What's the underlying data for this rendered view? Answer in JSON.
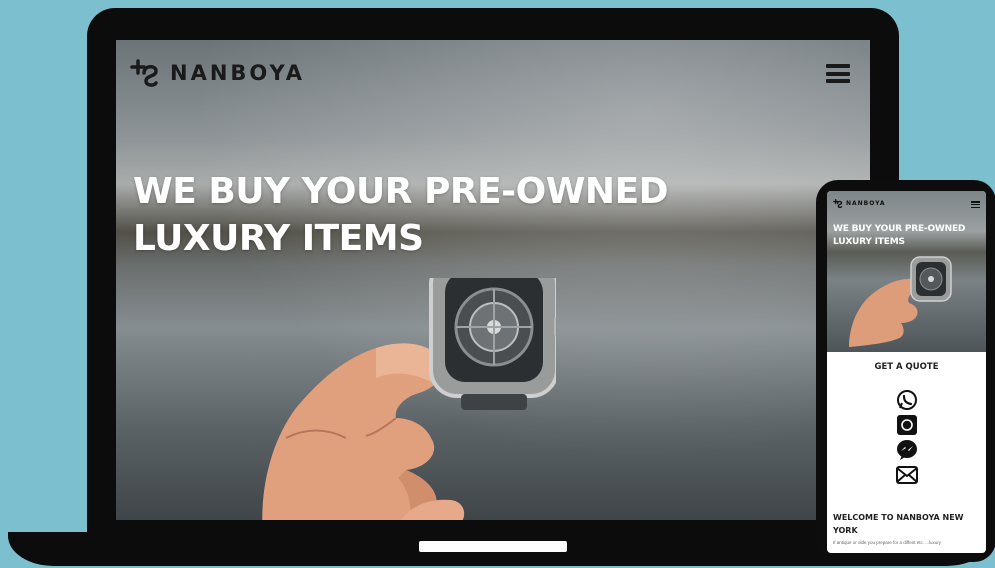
{
  "brand": {
    "name": "NANBOYA",
    "text_color": "#1a1a1a"
  },
  "desktop": {
    "headline_lines": [
      "WE BUY YOUR PRE-OWNED",
      "LUXURY ITEMS"
    ],
    "menu_icon": "hamburger-menu-icon"
  },
  "mobile": {
    "brand_name": "NANBOYA",
    "headline_lines": [
      "WE BUY YOUR PRE-OWNED",
      "LUXURY ITEMS"
    ],
    "quote_title": "GET A QUOTE",
    "contact_icons": [
      "whatsapp-icon",
      "instagram-icon",
      "messenger-icon",
      "email-icon"
    ],
    "welcome_lines": [
      "WELCOME TO NANBOYA NEW",
      "YORK"
    ],
    "welcome_body": "If antique or olde you prepare for a diffent etc. ...luxury"
  },
  "colors": {
    "background": "#7cc0cf",
    "device": "#0c0c0c",
    "headline": "#ffffff"
  }
}
